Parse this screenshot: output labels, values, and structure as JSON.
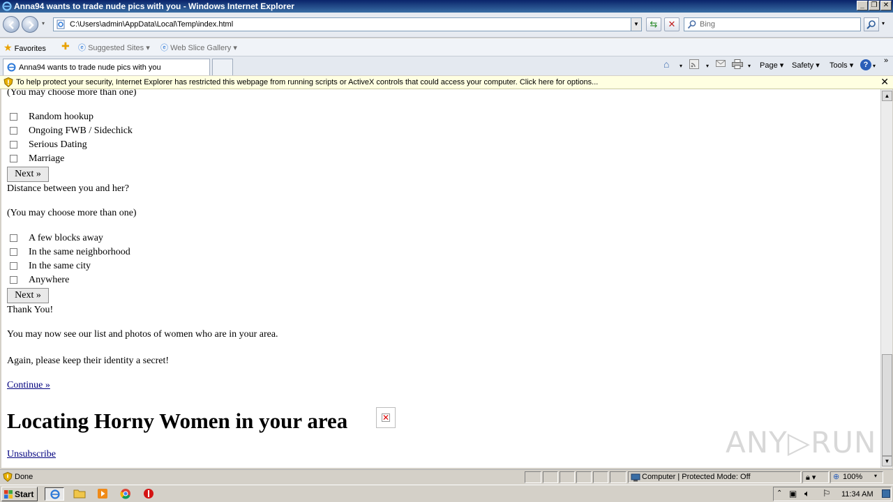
{
  "window": {
    "title": "Anna94 wants to trade nude pics with you - Windows Internet Explorer",
    "minimize": "_",
    "restore": "❐",
    "close": "✕"
  },
  "address": {
    "url": "C:\\Users\\admin\\AppData\\Local\\Temp\\index.html",
    "search_placeholder": "Bing"
  },
  "favorites": {
    "favorites_label": "Favorites",
    "suggested_sites": "Suggested Sites ▾",
    "web_slice_gallery": "Web Slice Gallery ▾"
  },
  "tabs": {
    "active_tab": "Anna94 wants to trade nude pics with you"
  },
  "command_bar": {
    "page": "Page ▾",
    "safety": "Safety ▾",
    "tools": "Tools ▾",
    "help": "?",
    "more": "»"
  },
  "infobar": {
    "message": "To help protect your security, Internet Explorer has restricted this webpage from running scripts or ActiveX controls that could access your computer. Click here for options...",
    "close": "✕"
  },
  "content": {
    "choose_more_top": "(You may choose more than one)",
    "relationship_options": [
      "Random hookup",
      "Ongoing FWB / Sidechick",
      "Serious Dating",
      "Marriage"
    ],
    "next_label": "Next »",
    "distance_question": "Distance between you and her?",
    "choose_more": "(You may choose more than one)",
    "distance_options": [
      "A few blocks away",
      "In the same neighborhood",
      "In the same city",
      "Anywhere"
    ],
    "thank_you": "Thank You!",
    "see_list": "You may now see our list and photos of women who are in your area.",
    "keep_secret": "Again, please keep their identity a secret!",
    "continue_link": "Continue »",
    "headline": "Locating Horny Women in your area",
    "unsubscribe_link": "Unsubscribe",
    "watermark": "ANY▷RUN"
  },
  "status": {
    "text": "Done",
    "zone": "Computer | Protected Mode: Off",
    "zoom": "100%"
  },
  "taskbar": {
    "start": "Start",
    "clock": "11:34 AM"
  },
  "colors": {
    "titlebar": "#0a246a",
    "infobar": "#ffffe1",
    "link": "#00007f"
  }
}
